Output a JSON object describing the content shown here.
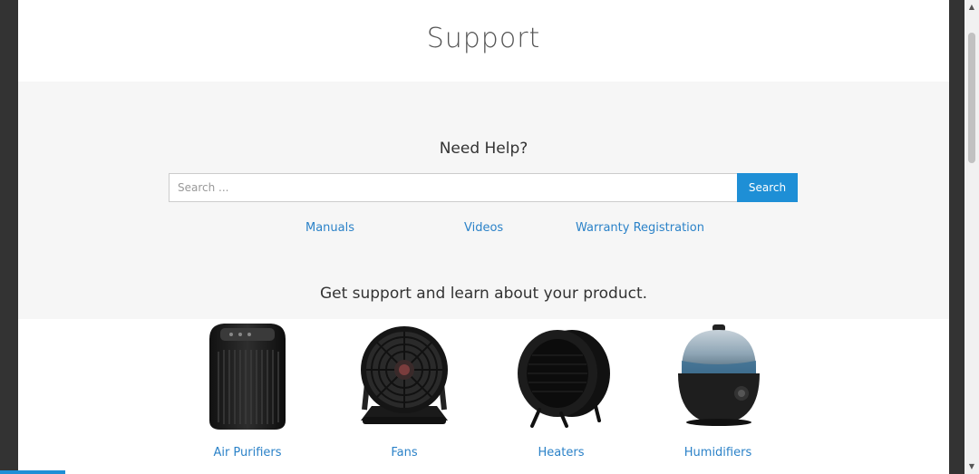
{
  "header": {
    "title": "Support"
  },
  "help": {
    "title": "Need Help?",
    "search": {
      "placeholder": "Search ...",
      "value": "",
      "button_label": "Search"
    },
    "links": [
      "Manuals",
      "Videos",
      "Warranty Registration"
    ]
  },
  "support": {
    "text": "Get support and learn about your product."
  },
  "products": [
    {
      "label": "Air Purifiers",
      "icon": "air-purifier-icon"
    },
    {
      "label": "Fans",
      "icon": "fan-icon"
    },
    {
      "label": "Heaters",
      "icon": "heater-icon"
    },
    {
      "label": "Humidifiers",
      "icon": "humidifier-icon"
    }
  ],
  "colors": {
    "accent": "#1e8fd6",
    "link": "#2b82c8",
    "panel": "#f6f6f6",
    "frame": "#333333"
  }
}
